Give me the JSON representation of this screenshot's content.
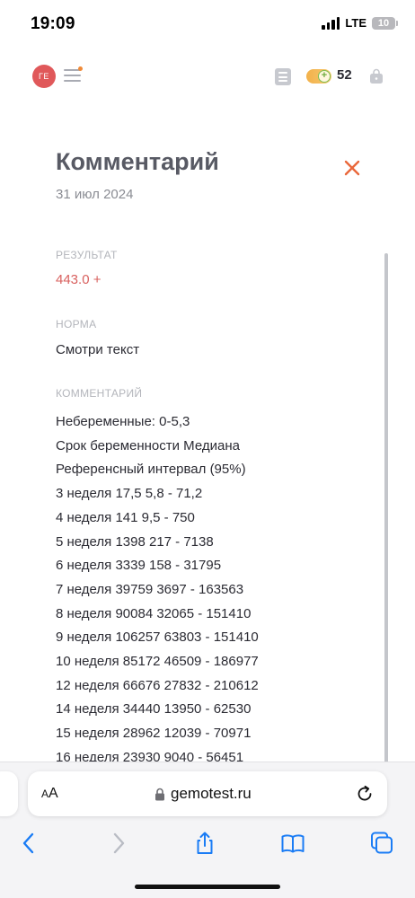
{
  "status_bar": {
    "time": "19:09",
    "network": "LTE",
    "battery": "10"
  },
  "app_header": {
    "avatar_initials": "ГЕ",
    "coins": "52",
    "icons": [
      "menu-icon",
      "list-icon",
      "coin-add-icon",
      "shopping-bag-icon"
    ],
    "accent_color": "#e0585a"
  },
  "modal": {
    "title": "Комментарий",
    "date": "31 июл 2024",
    "close_icon": "close-x-icon",
    "close_color": "#e9673a"
  },
  "result": {
    "label": "РЕЗУЛЬТАТ",
    "value": "443.0 +",
    "value_color": "#d8605e"
  },
  "norm": {
    "label": "НОРМА",
    "value": "Смотри текст"
  },
  "comment": {
    "label": "КОММЕНТАРИЙ",
    "lines": [
      "Небеременные: 0-5,3",
      "Срок беременности Медиана",
      "Референсный интервал (95%)",
      "3 неделя 17,5 5,8 - 71,2",
      "4 неделя 141 9,5 - 750",
      "5 неделя 1398 217 - 7138",
      "6 неделя 3339 158 - 31795",
      "7 неделя 39759 3697 - 163563",
      "8 неделя 90084 32065 - 151410",
      "9 неделя 106257 63803 - 151410",
      "10 неделя 85172 46509 - 186977",
      "12 неделя 66676 27832 - 210612",
      "14 неделя 34440 13950 - 62530",
      "15 неделя 28962 12039 - 70971",
      "16 неделя 23930 9040 - 56451"
    ]
  },
  "browser": {
    "aa_small": "A",
    "aa_large": "A",
    "url": "gemotest.ru",
    "toolbar_icons": [
      "back-icon",
      "forward-icon",
      "share-icon",
      "bookmarks-icon",
      "tabs-icon"
    ],
    "accent_color": "#1a7cf5"
  }
}
